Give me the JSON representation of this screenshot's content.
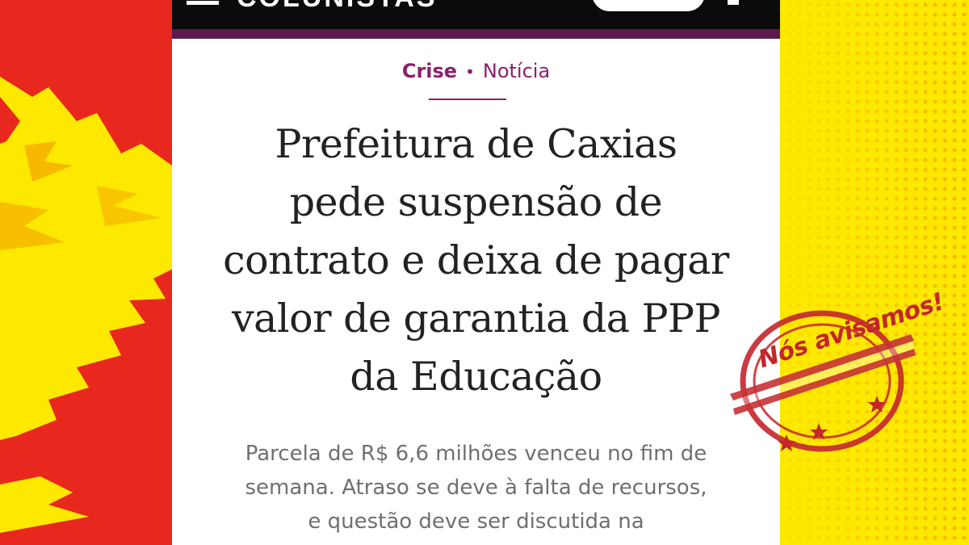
{
  "header": {
    "brand": "COLUNISTAS"
  },
  "article": {
    "category": "Crise",
    "separator": "•",
    "type": "Notícia",
    "headline_lines": [
      "Prefeitura de Caxias",
      "pede suspensão de",
      "contrato e deixa de pagar",
      "valor de garantia da PPP",
      "da Educação"
    ],
    "subhead_lines": [
      "Parcela de R$ 6,6 milhões venceu no fim de",
      "semana. Atraso se deve à falta de recursos,",
      "e questão deve ser discutida na"
    ]
  },
  "stamp": {
    "text": "Nós avisamos!",
    "icon": "star-icon"
  },
  "colors": {
    "background_yellow": "#fde800",
    "background_red": "#e8281e",
    "header_black": "#0b0b0b",
    "accent_purple": "#5b1a4b",
    "category_magenta": "#8a1f6e",
    "headline_text": "#222222",
    "subhead_text": "#6f6f6f",
    "stamp_red": "#c3262c"
  }
}
